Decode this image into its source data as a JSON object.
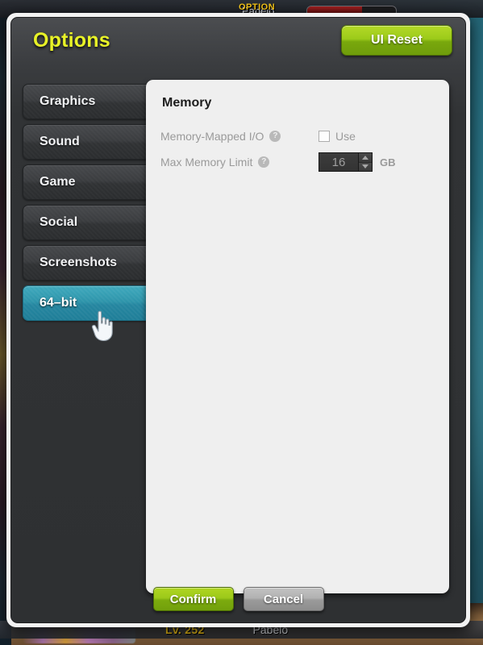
{
  "background": {
    "hud": {
      "option_tag": "OPTION",
      "character_name": "Pabelo",
      "hp_percent": 62
    },
    "nameplate": {
      "level": "Lv. 252",
      "character_name": "Pabelo"
    }
  },
  "dialog": {
    "title": "Options",
    "ui_reset_label": "UI Reset"
  },
  "sidebar": {
    "items": [
      {
        "label": "Graphics",
        "active": false
      },
      {
        "label": "Sound",
        "active": false
      },
      {
        "label": "Game",
        "active": false
      },
      {
        "label": "Social",
        "active": false
      },
      {
        "label": "Screenshots",
        "active": false
      },
      {
        "label": "64–bit",
        "active": true
      }
    ]
  },
  "content": {
    "section_title": "Memory",
    "rows": [
      {
        "label": "Memory-Mapped I/O",
        "help_icon": "question-mark-icon",
        "control": "checkbox",
        "checkbox_label": "Use",
        "checked": false,
        "enabled": false
      },
      {
        "label": "Max Memory Limit",
        "help_icon": "question-mark-icon",
        "control": "spinner",
        "value": "16",
        "unit": "GB",
        "enabled": false
      }
    ]
  },
  "footer": {
    "confirm_label": "Confirm",
    "cancel_label": "Cancel"
  },
  "colors": {
    "title_yellow": "#e8f227",
    "accent_green": "#9ccb1a",
    "active_tab_teal": "#2e95ab",
    "panel_bg": "#efefef",
    "window_dark": "#303234"
  }
}
